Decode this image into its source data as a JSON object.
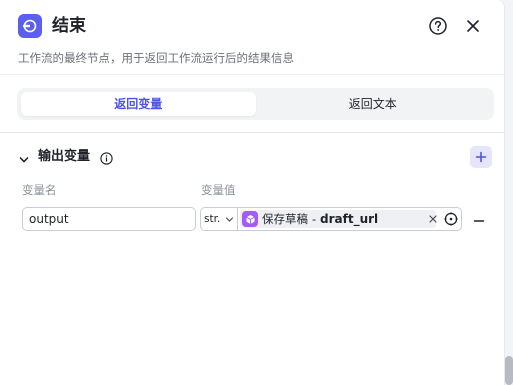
{
  "header": {
    "title": "结束",
    "node_icon": "end-node-icon",
    "help_icon": "help-circle-icon",
    "close_icon": "close-icon"
  },
  "description": "工作流的最终节点，用于返回工作流运行后的结果信息",
  "tabs": [
    {
      "label": "返回变量",
      "active": true
    },
    {
      "label": "返回文本",
      "active": false
    }
  ],
  "output_section": {
    "title": "输出变量",
    "columns": {
      "name": "变量名",
      "value": "变量值"
    },
    "rows": [
      {
        "name": "output",
        "type": "str.",
        "ref_node": "保存草稿",
        "ref_separator": "-",
        "ref_variable": "draft_url"
      }
    ]
  },
  "colors": {
    "accent": "#4d53e8",
    "node_icon_bg": "#5b5ff0",
    "ref_node_icon_bg": "#a35cf5"
  }
}
